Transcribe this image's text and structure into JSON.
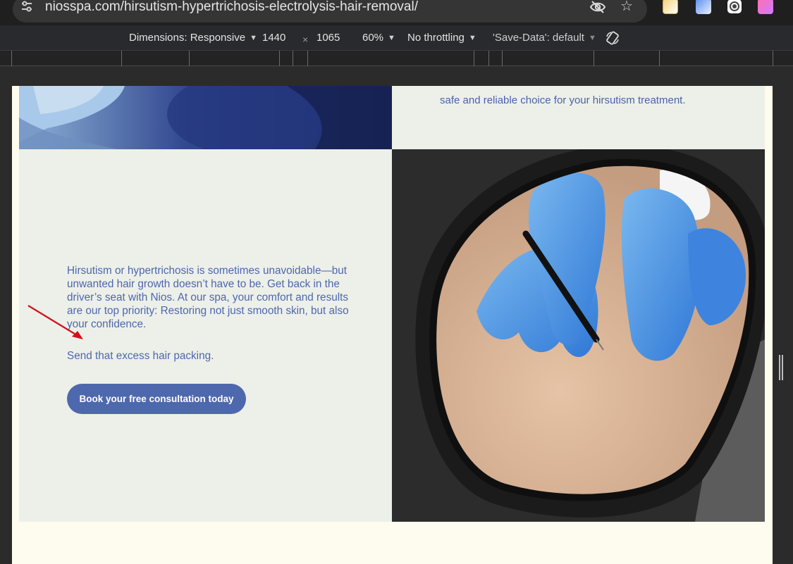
{
  "browser": {
    "url": "niosspa.com/hirsutism-hypertrichosis-electrolysis-hair-removal/",
    "icons": [
      "site-settings-icon",
      "hide-eye-icon",
      "bookmark-star-icon",
      "extension-note-icon",
      "extension-docs-icon",
      "extension-record-icon",
      "extension-profile-icon"
    ]
  },
  "devtools": {
    "dimensions_label": "Dimensions: Responsive",
    "width_value": "1440",
    "times": "×",
    "height_value": "1065",
    "zoom": "60%",
    "throttling": "No throttling",
    "save_data": "'Save-Data': default"
  },
  "page": {
    "top_right_text": "safe and reliable choice for your hirsutism treatment.",
    "body_text": "Hirsutism or hypertrichosis is sometimes unavoidable—but unwanted hair growth doesn’t have to be. Get back in the driver’s seat with Nios. At our spa, your comfort and results are our top priority: Restoring not just smooth skin, but also your confidence.",
    "tagline": "Send that excess hair packing.",
    "cta_label": "Book your free consultation today",
    "text_color": "#4d66ad",
    "panel_color": "#edf0e9",
    "page_bg": "#fefcee"
  },
  "annotation": {
    "arrow_color": "#d0121b"
  }
}
